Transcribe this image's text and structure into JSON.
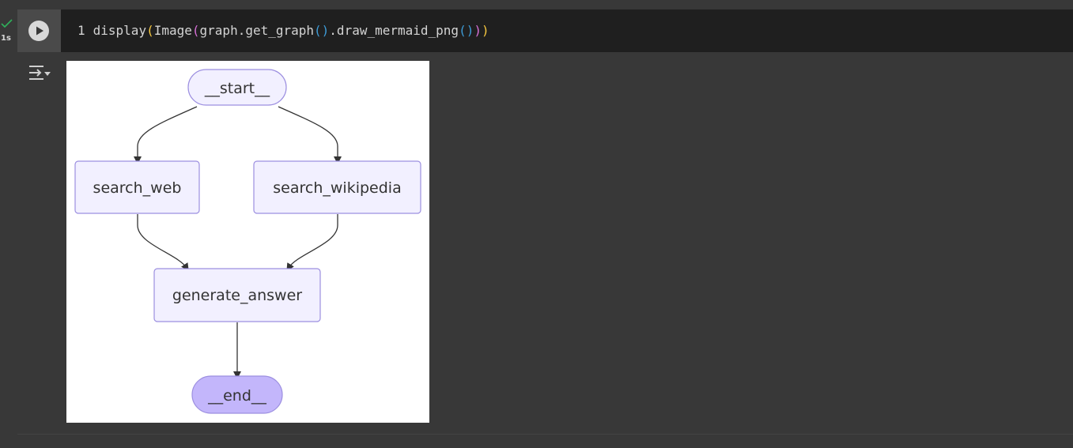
{
  "cell": {
    "status_time": "1s",
    "line_number": "1",
    "code": {
      "fn_display": "display",
      "fn_image": "Image",
      "call_get_graph": "graph.get_graph",
      "call_draw": ".draw_mermaid_png"
    }
  },
  "icons": {
    "status": "checkmark-icon",
    "run": "play-icon",
    "output_toggle": "output-toggle-icon"
  },
  "diagram": {
    "nodes": {
      "start": "__start__",
      "search_web": "search_web",
      "search_wikipedia": "search_wikipedia",
      "generate_answer": "generate_answer",
      "end": "__end__"
    }
  },
  "colors": {
    "node_fill": "#f2f0ff",
    "node_stroke": "#9c8fe0",
    "end_fill": "#c3b6fb",
    "edge": "#333333",
    "editor_bg": "#1f1f1f",
    "page_bg": "#383838"
  }
}
